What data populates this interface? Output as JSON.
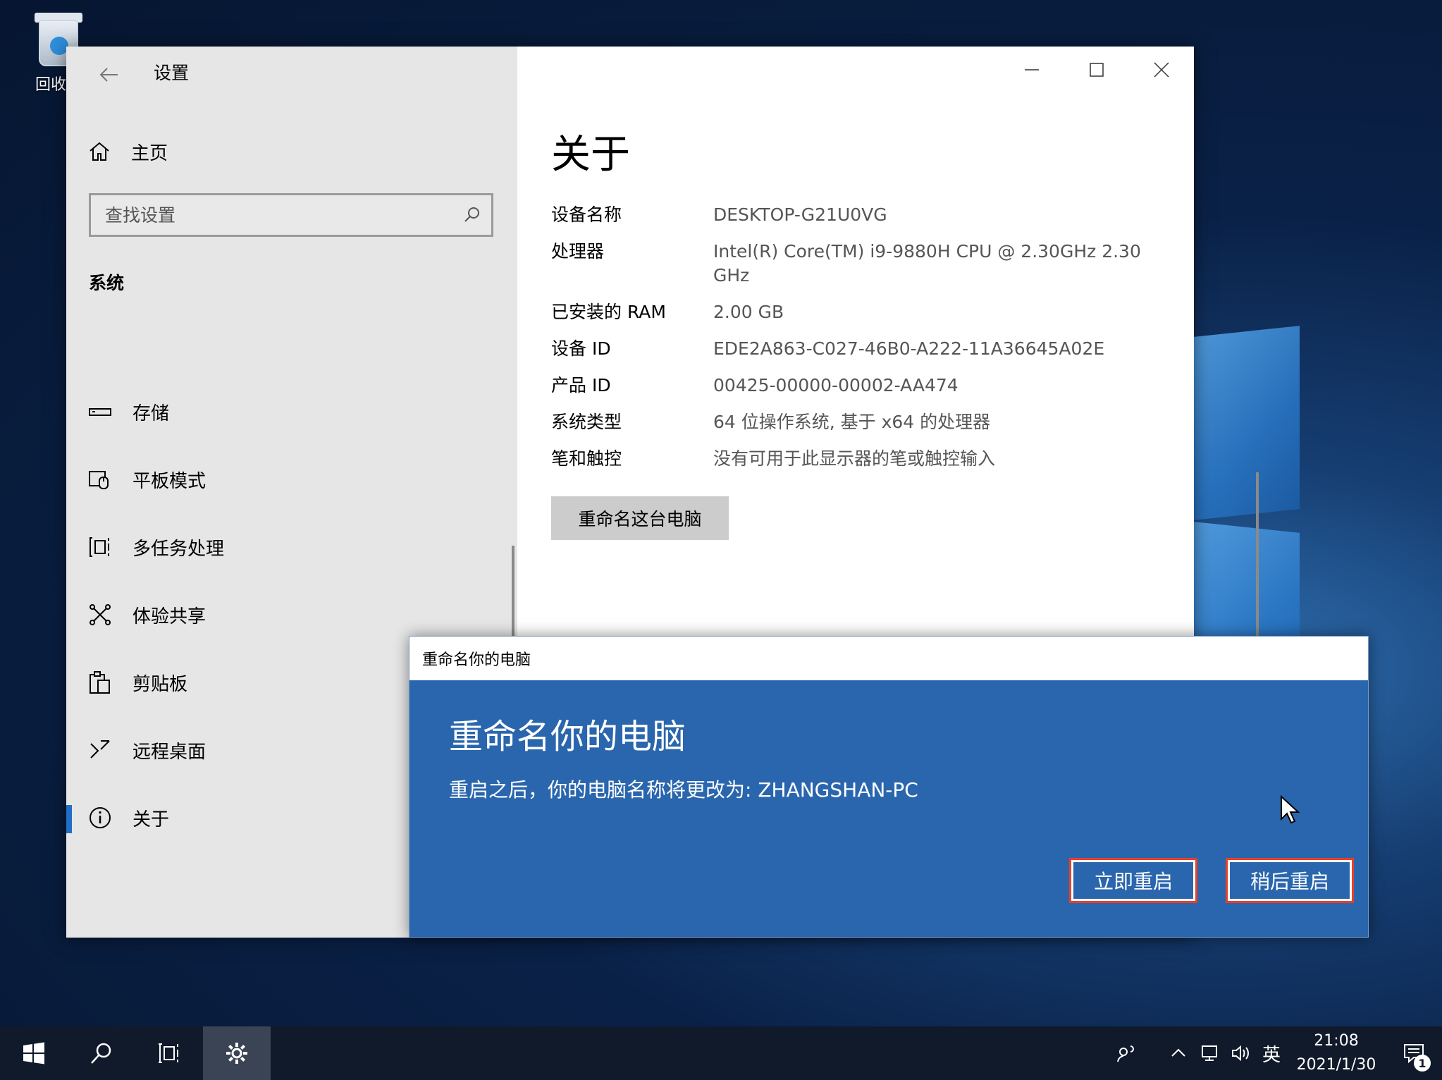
{
  "desktop": {
    "icon_label": "回收站"
  },
  "settings": {
    "title": "设置",
    "home_label": "主页",
    "search": {
      "placeholder": "查找设置"
    },
    "section_title": "系统",
    "nav_items": [
      {
        "label": "存储",
        "icon": "storage-icon"
      },
      {
        "label": "平板模式",
        "icon": "tablet-mode-icon"
      },
      {
        "label": "多任务处理",
        "icon": "multitasking-icon"
      },
      {
        "label": "体验共享",
        "icon": "shared-experiences-icon"
      },
      {
        "label": "剪贴板",
        "icon": "clipboard-icon"
      },
      {
        "label": "远程桌面",
        "icon": "remote-desktop-icon"
      },
      {
        "label": "关于",
        "icon": "info-icon",
        "active": true
      }
    ],
    "about": {
      "title": "关于",
      "specs": [
        {
          "key": "设备名称",
          "value": "DESKTOP-G21U0VG"
        },
        {
          "key": "处理器",
          "value": "Intel(R) Core(TM) i9-9880H CPU @ 2.30GHz   2.30 GHz"
        },
        {
          "key": "已安装的 RAM",
          "value": "2.00 GB"
        },
        {
          "key": "设备 ID",
          "value": "EDE2A863-C027-46B0-A222-11A36645A02E"
        },
        {
          "key": "产品 ID",
          "value": "00425-00000-00002-AA474"
        },
        {
          "key": "系统类型",
          "value": "64 位操作系统, 基于 x64 的处理器"
        },
        {
          "key": "笔和触控",
          "value": "没有可用于此显示器的笔或触控输入"
        }
      ],
      "rename_button": "重命名这台电脑"
    }
  },
  "dialog": {
    "window_title": "重命名你的电脑",
    "heading": "重命名你的电脑",
    "message": "重启之后，你的电脑名称将更改为: ZHANGSHAN-PC",
    "restart_now": "立即重启",
    "restart_later": "稍后重启",
    "highlight_color": "#e8402a",
    "background_color": "#2a66ad"
  },
  "taskbar": {
    "ime": "英",
    "time": "21:08",
    "date": "2021/1/30",
    "notification_count": "1"
  }
}
